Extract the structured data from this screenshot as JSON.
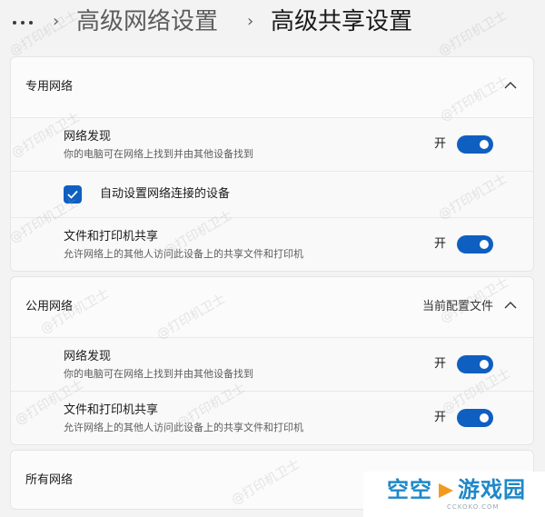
{
  "breadcrumb": {
    "items": [
      "高级网络设置",
      "高级共享设置"
    ]
  },
  "sections": {
    "private": {
      "title": "专用网络",
      "discovery": {
        "label": "网络发现",
        "description": "你的电脑可在网络上找到并由其他设备找到",
        "state": "开"
      },
      "auto_setup": {
        "label": "自动设置网络连接的设备",
        "checked": true
      },
      "sharing": {
        "label": "文件和打印机共享",
        "description": "允许网络上的其他人访问此设备上的共享文件和打印机",
        "state": "开"
      }
    },
    "public": {
      "title": "公用网络",
      "status": "当前配置文件",
      "discovery": {
        "label": "网络发现",
        "description": "你的电脑可在网络上找到并由其他设备找到",
        "state": "开"
      },
      "sharing": {
        "label": "文件和打印机共享",
        "description": "允许网络上的其他人访问此设备上的共享文件和打印机",
        "state": "开"
      }
    },
    "all": {
      "title": "所有网络"
    }
  },
  "watermark": "@打印机卫士",
  "corner_logo": {
    "text_left": "空空",
    "text_right": "游戏园",
    "subtext": "CCKOKO.COM"
  },
  "colors": {
    "accent": "#0f5fc1",
    "background": "#f3f3f3",
    "card": "#fbfbfb",
    "logo": "#1e88c8",
    "logo_mark": "#f39a1e"
  }
}
